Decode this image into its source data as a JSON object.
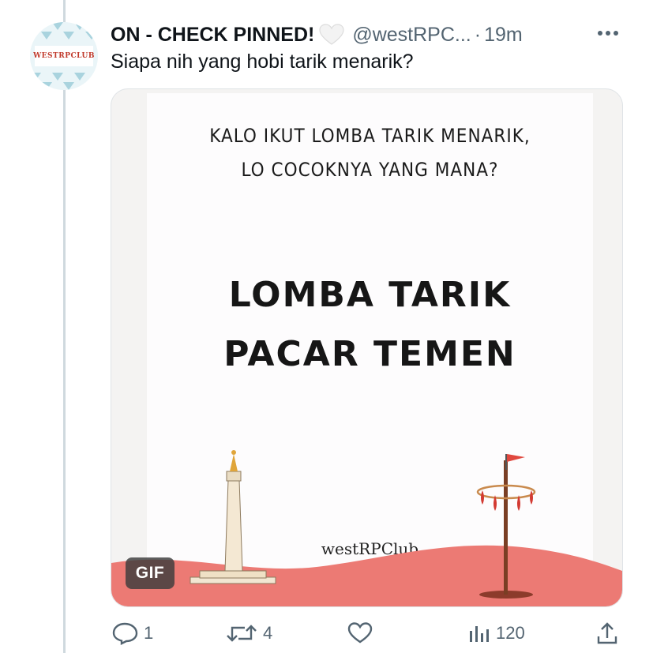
{
  "tweet": {
    "display_name": "ON - CHECK PINNED!",
    "handle": "@westRPC...",
    "separator": "·",
    "time": "19m",
    "text": "Siapa nih yang hobi tarik menarik?",
    "avatar_text": "WESTRPCLUB"
  },
  "media": {
    "question_line_1": "KALO IKUT LOMBA TARIK MENARIK,",
    "question_line_2": "LO COCOKNYA YANG MANA?",
    "headline_line_1": "LOMBA TARIK",
    "headline_line_2": "PACAR TEMEN",
    "brand": "westRPClub",
    "badge": "GIF"
  },
  "actions": {
    "replies": "1",
    "retweets": "4",
    "likes": "",
    "views": "120"
  },
  "colors": {
    "text_primary": "#0f1419",
    "text_secondary": "#536471",
    "thread_line": "#cfd9de",
    "ground": "#ec7a74"
  },
  "icons": [
    "white-heart-icon",
    "more-icon",
    "reply-icon",
    "retweet-icon",
    "like-icon",
    "views-icon",
    "share-icon"
  ]
}
